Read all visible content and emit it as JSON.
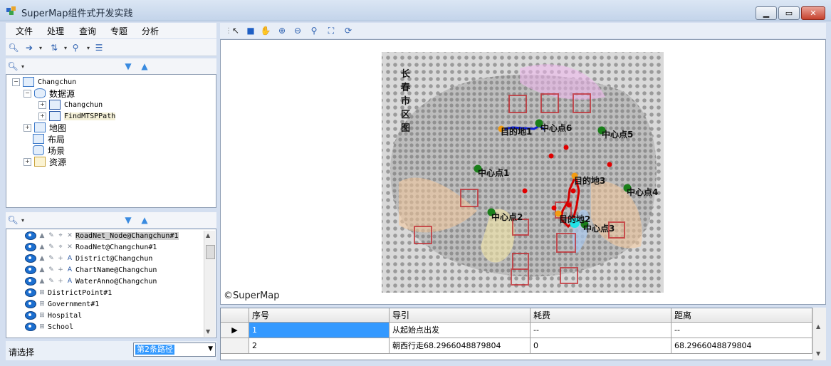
{
  "window": {
    "title": "SuperMap组件式开发实践"
  },
  "menu": [
    "文件",
    "处理",
    "查询",
    "专题",
    "分析"
  ],
  "workspace_tree": {
    "root": "Changchun",
    "datasources_label": "数据源",
    "datasources": [
      "Changchun",
      "FindMTSPPath"
    ],
    "nodes": [
      "地图",
      "布局",
      "场景",
      "资源"
    ]
  },
  "layers": [
    "RoadNet_Node@Changchun#1",
    "RoadNet@Changchun#1",
    "District@Changchun",
    "ChartName@Changchun",
    "WaterAnno@Changchun",
    "DistrictPoint#1",
    "Government#1",
    "Hospital",
    "School"
  ],
  "status": {
    "label": "请选择",
    "selected_path": "第2条路径"
  },
  "map": {
    "copyright": "©SuperMap",
    "centers": [
      "中心点1",
      "中心点2",
      "中心点3",
      "中心点4",
      "中心点5",
      "中心点6"
    ],
    "destinations": [
      "目的地1",
      "目的地2",
      "目的地3"
    ],
    "district_label_chars": [
      "长",
      "春",
      "市",
      "区",
      "图"
    ],
    "colors": {
      "center": "#1a7f1a",
      "destination": "#f39c12",
      "route_red": "#d40000",
      "route_blue": "#1020d0",
      "start": "#21e3e8"
    }
  },
  "grid": {
    "headers": [
      "序号",
      "导引",
      "耗费",
      "距离"
    ],
    "rows": [
      [
        "1",
        "从起始点出发",
        "--",
        "--"
      ],
      [
        "2",
        "朝西行走68.2966048879804",
        "0",
        "68.2966048879804"
      ]
    ]
  }
}
